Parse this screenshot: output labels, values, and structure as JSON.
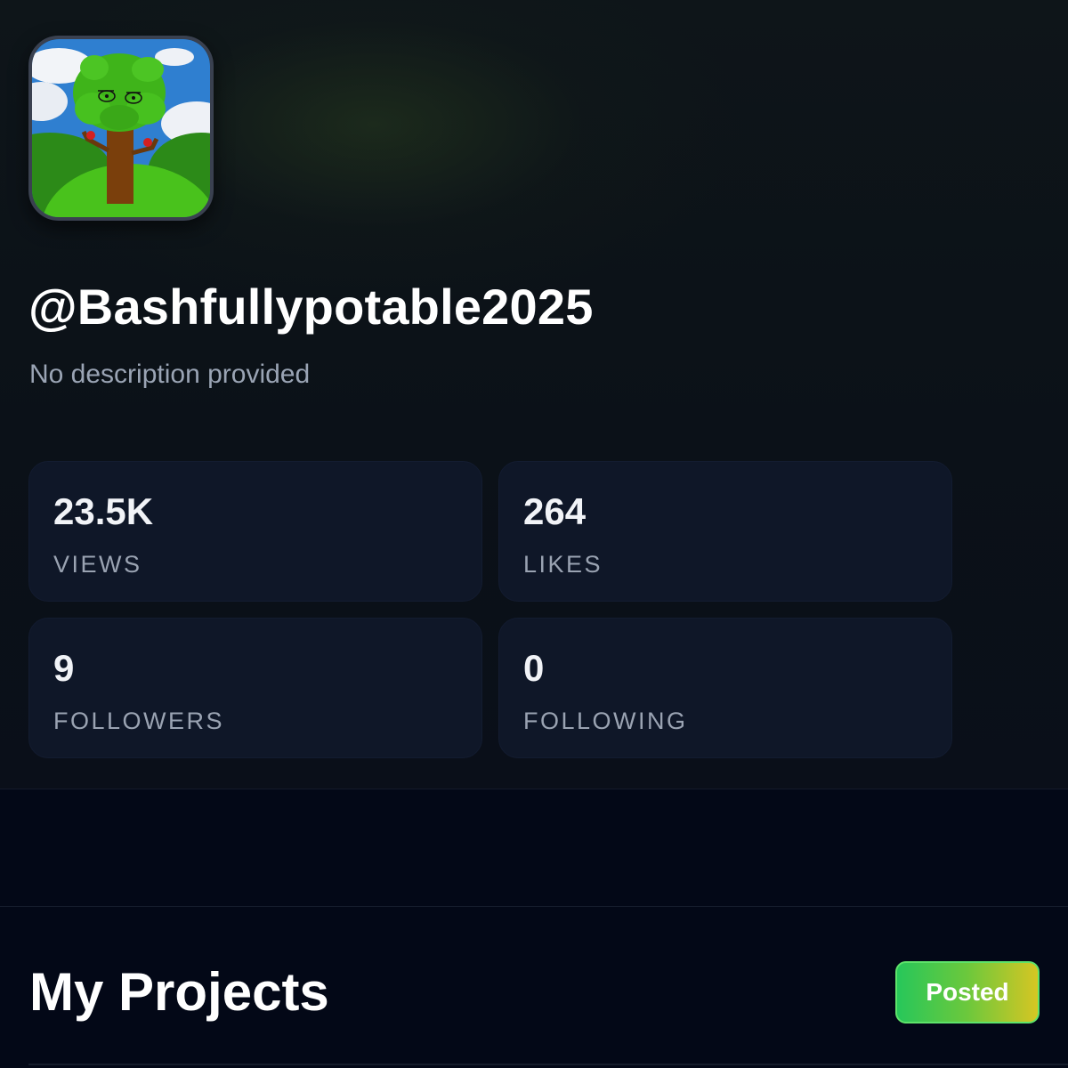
{
  "profile": {
    "username": "@Bashfullypotable2025",
    "description": "No description provided",
    "avatar_icon": "tree-character-avatar"
  },
  "stats": {
    "views": {
      "value": "23.5K",
      "label": "VIEWS"
    },
    "likes": {
      "value": "264",
      "label": "LIKES"
    },
    "followers": {
      "value": "9",
      "label": "FOLLOWERS"
    },
    "following": {
      "value": "0",
      "label": "FOLLOWING"
    }
  },
  "projects": {
    "title": "My Projects",
    "filter_button": "Posted"
  },
  "colors": {
    "background": "#030817",
    "card": "#0f1728",
    "label": "#9aa3b2",
    "button_gradient_start": "#27c75a",
    "button_gradient_end": "#d6c623"
  }
}
